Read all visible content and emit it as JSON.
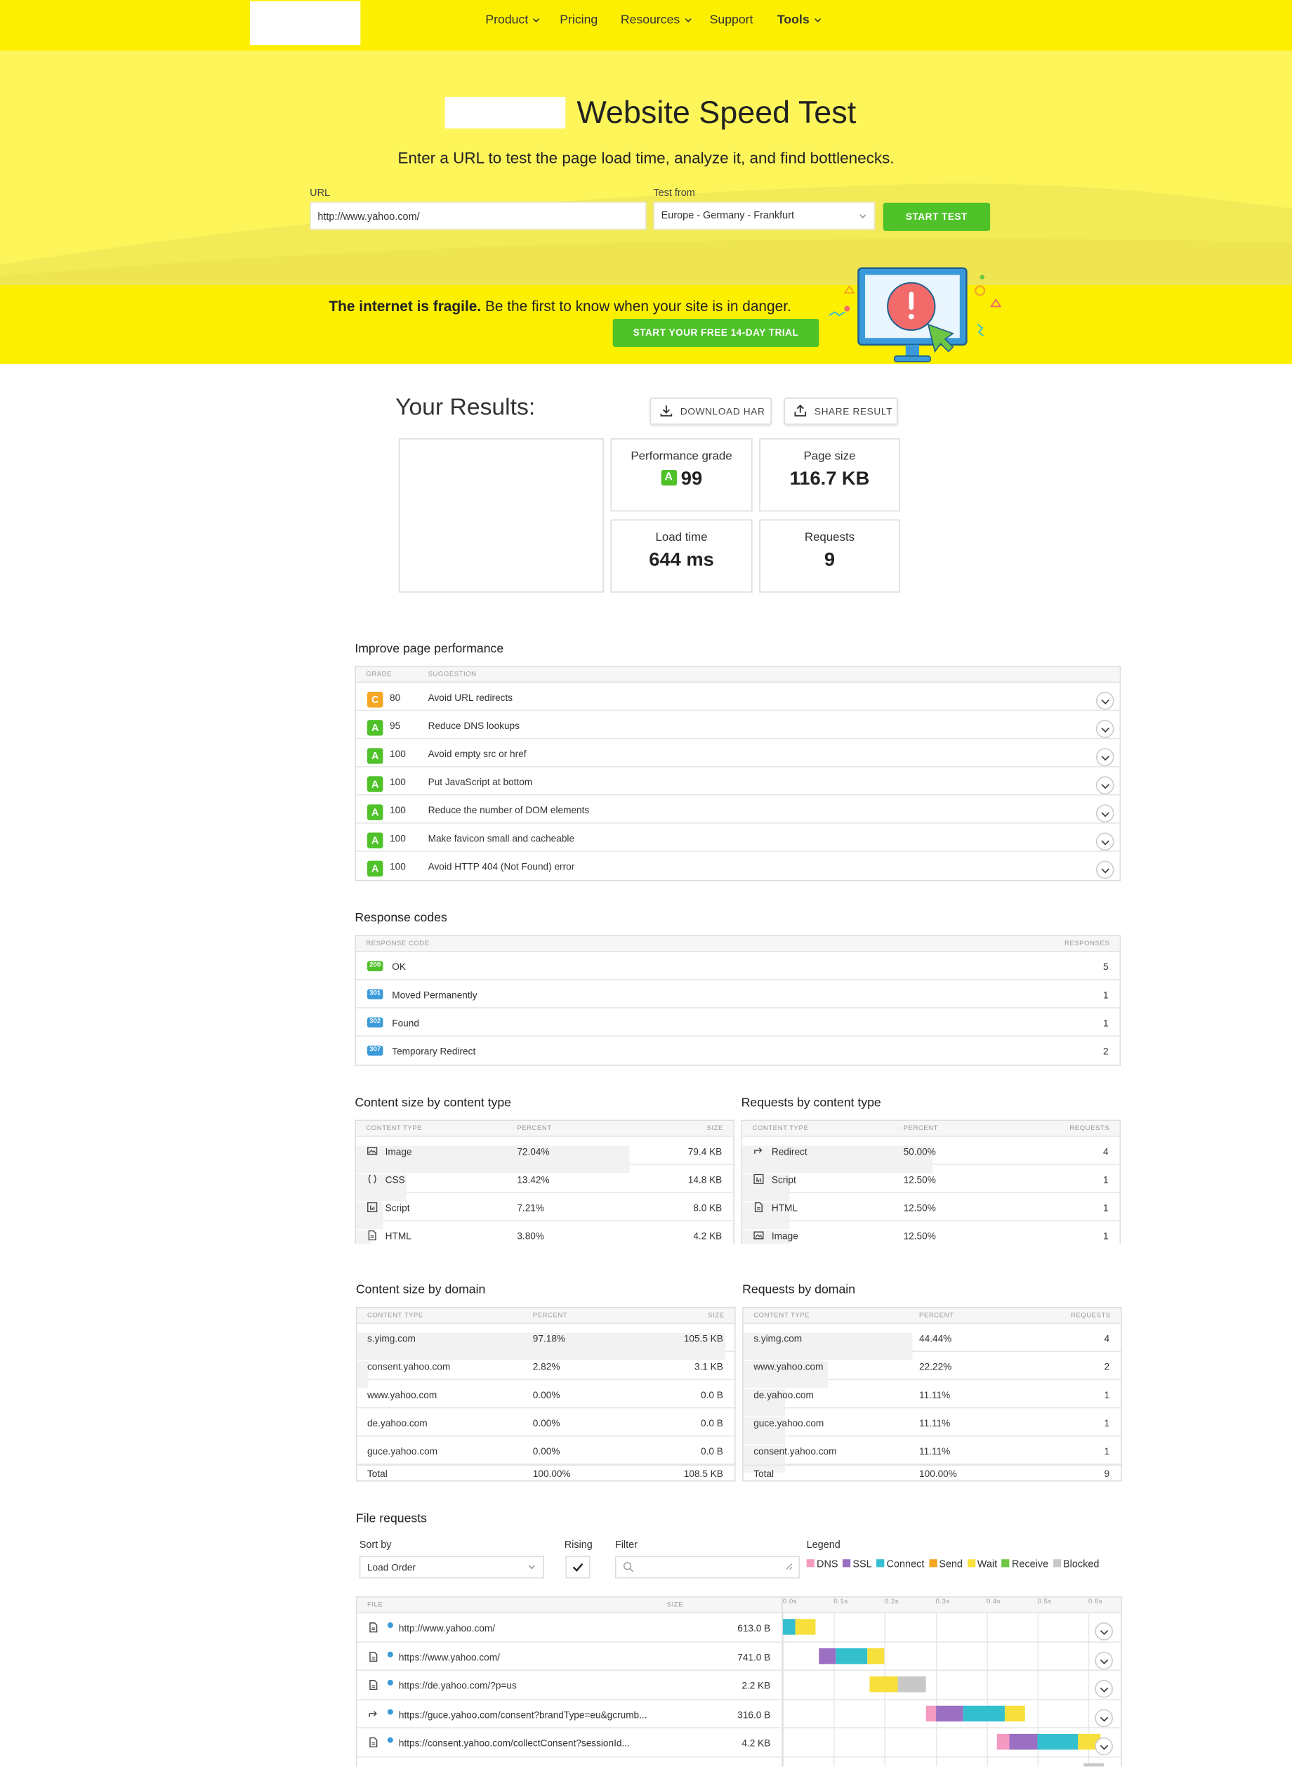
{
  "nav": {
    "items": [
      {
        "label": "Product",
        "dropdown": true
      },
      {
        "label": "Pricing",
        "dropdown": false
      },
      {
        "label": "Resources",
        "dropdown": true
      },
      {
        "label": "Support",
        "dropdown": false
      },
      {
        "label": "Tools",
        "dropdown": true
      }
    ]
  },
  "hero": {
    "title": "Website Speed Test",
    "subtitle": "Enter a URL to test the page load time, analyze it, and find bottlenecks.",
    "url_label": "URL",
    "url_value": "http://www.yahoo.com/",
    "test_from_label": "Test from",
    "test_from_value": "Europe - Germany - Frankfurt",
    "start_button": "START TEST"
  },
  "promo": {
    "bold": "The internet is fragile.",
    "text": " Be the first to know when your site is in danger.",
    "button": "START YOUR FREE 14-DAY TRIAL"
  },
  "results": {
    "title": "Your Results:",
    "download_har": "DOWNLOAD HAR",
    "share_result": "SHARE RESULT",
    "performance_grade_label": "Performance grade",
    "performance_grade_letter": "A",
    "performance_grade_value": "99",
    "page_size_label": "Page size",
    "page_size_value": "116.7 KB",
    "load_time_label": "Load time",
    "load_time_value": "644 ms",
    "requests_label": "Requests",
    "requests_value": "9"
  },
  "improve": {
    "title": "Improve page performance",
    "col_grade": "GRADE",
    "col_suggestion": "SUGGESTION",
    "rows": [
      {
        "grade": "C",
        "score": "80",
        "suggestion": "Avoid URL redirects",
        "color": "#f5a623"
      },
      {
        "grade": "A",
        "score": "95",
        "suggestion": "Reduce DNS lookups",
        "color": "#4fc22a"
      },
      {
        "grade": "A",
        "score": "100",
        "suggestion": "Avoid empty src or href",
        "color": "#4fc22a"
      },
      {
        "grade": "A",
        "score": "100",
        "suggestion": "Put JavaScript at bottom",
        "color": "#4fc22a"
      },
      {
        "grade": "A",
        "score": "100",
        "suggestion": "Reduce the number of DOM elements",
        "color": "#4fc22a"
      },
      {
        "grade": "A",
        "score": "100",
        "suggestion": "Make favicon small and cacheable",
        "color": "#4fc22a"
      },
      {
        "grade": "A",
        "score": "100",
        "suggestion": "Avoid HTTP 404 (Not Found) error",
        "color": "#4fc22a"
      }
    ]
  },
  "response_codes": {
    "title": "Response codes",
    "col_code": "RESPONSE CODE",
    "col_responses": "RESPONSES",
    "rows": [
      {
        "code": "200",
        "label": "OK",
        "count": "5",
        "color": "#4fc22a"
      },
      {
        "code": "301",
        "label": "Moved Permanently",
        "count": "1",
        "color": "#3a9ad9"
      },
      {
        "code": "302",
        "label": "Found",
        "count": "1",
        "color": "#3a9ad9"
      },
      {
        "code": "307",
        "label": "Temporary Redirect",
        "count": "2",
        "color": "#3a9ad9"
      }
    ]
  },
  "content_size_type": {
    "title": "Content size by content type",
    "col_type": "CONTENT TYPE",
    "col_percent": "PERCENT",
    "col_size": "SIZE",
    "rows": [
      {
        "type": "Image",
        "icon": "image-icon",
        "percent": "72.04%",
        "fraction": 0.7204,
        "size": "79.4 KB"
      },
      {
        "type": "CSS",
        "icon": "css-icon",
        "percent": "13.42%",
        "fraction": 0.1342,
        "size": "14.8 KB"
      },
      {
        "type": "Script",
        "icon": "script-icon",
        "percent": "7.21%",
        "fraction": 0.0721,
        "size": "8.0 KB"
      },
      {
        "type": "HTML",
        "icon": "html-icon",
        "percent": "3.80%",
        "fraction": 0.038,
        "size": "4.2 KB"
      }
    ]
  },
  "requests_type": {
    "title": "Requests by content type",
    "col_type": "CONTENT TYPE",
    "col_percent": "PERCENT",
    "col_requests": "REQUESTS",
    "rows": [
      {
        "type": "Redirect",
        "icon": "redirect-icon",
        "percent": "50.00%",
        "fraction": 0.5,
        "count": "4"
      },
      {
        "type": "Script",
        "icon": "script-icon",
        "percent": "12.50%",
        "fraction": 0.125,
        "count": "1"
      },
      {
        "type": "HTML",
        "icon": "html-icon",
        "percent": "12.50%",
        "fraction": 0.125,
        "count": "1"
      },
      {
        "type": "Image",
        "icon": "image-icon",
        "percent": "12.50%",
        "fraction": 0.125,
        "count": "1"
      }
    ]
  },
  "content_size_domain": {
    "title": "Content size by domain",
    "col_type": "CONTENT TYPE",
    "col_percent": "PERCENT",
    "col_size": "SIZE",
    "rows": [
      {
        "domain": "s.yimg.com",
        "percent": "97.18%",
        "fraction": 0.9718,
        "size": "105.5 KB"
      },
      {
        "domain": "consent.yahoo.com",
        "percent": "2.82%",
        "fraction": 0.0282,
        "size": "3.1 KB"
      },
      {
        "domain": "www.yahoo.com",
        "percent": "0.00%",
        "fraction": 0,
        "size": "0.0 B"
      },
      {
        "domain": "de.yahoo.com",
        "percent": "0.00%",
        "fraction": 0,
        "size": "0.0 B"
      },
      {
        "domain": "guce.yahoo.com",
        "percent": "0.00%",
        "fraction": 0,
        "size": "0.0 B"
      }
    ],
    "total_label": "Total",
    "total_percent": "100.00%",
    "total_size": "108.5 KB"
  },
  "requests_domain": {
    "title": "Requests by domain",
    "col_type": "CONTENT TYPE",
    "col_percent": "PERCENT",
    "col_requests": "REQUESTS",
    "rows": [
      {
        "domain": "s.yimg.com",
        "percent": "44.44%",
        "fraction": 0.4444,
        "count": "4"
      },
      {
        "domain": "www.yahoo.com",
        "percent": "22.22%",
        "fraction": 0.2222,
        "count": "2"
      },
      {
        "domain": "de.yahoo.com",
        "percent": "11.11%",
        "fraction": 0.1111,
        "count": "1"
      },
      {
        "domain": "guce.yahoo.com",
        "percent": "11.11%",
        "fraction": 0.1111,
        "count": "1"
      },
      {
        "domain": "consent.yahoo.com",
        "percent": "11.11%",
        "fraction": 0.1111,
        "count": "1"
      }
    ],
    "total_label": "Total",
    "total_percent": "100.00%",
    "total_count": "9"
  },
  "file_requests": {
    "title": "File requests",
    "sort_label": "Sort by",
    "sort_value": "Load Order",
    "rising_label": "Rising",
    "filter_label": "Filter",
    "filter_value": "",
    "legend_label": "Legend",
    "legend": [
      {
        "name": "DNS",
        "color": "#f49ac1"
      },
      {
        "name": "SSL",
        "color": "#9b6fc2"
      },
      {
        "name": "Connect",
        "color": "#34bfcf"
      },
      {
        "name": "Send",
        "color": "#f5a623"
      },
      {
        "name": "Wait",
        "color": "#f7e03c"
      },
      {
        "name": "Receive",
        "color": "#6cc644"
      },
      {
        "name": "Blocked",
        "color": "#c8c8c8"
      }
    ],
    "col_file": "FILE",
    "col_size": "SIZE",
    "ticks": [
      "0.0s",
      "0.1s",
      "0.2s",
      "0.3s",
      "0.4s",
      "0.5s",
      "0.6s"
    ],
    "rows": [
      {
        "url": "http://www.yahoo.com/",
        "size": "613.0 B",
        "icon": "document-icon",
        "phases": [
          {
            "p": "Connect",
            "s": 0.0,
            "e": 0.025
          },
          {
            "p": "Wait",
            "s": 0.025,
            "e": 0.065
          }
        ]
      },
      {
        "url": "https://www.yahoo.com/",
        "size": "741.0 B",
        "icon": "document-icon",
        "phases": [
          {
            "p": "SSL",
            "s": 0.07,
            "e": 0.105
          },
          {
            "p": "Connect",
            "s": 0.105,
            "e": 0.165
          },
          {
            "p": "Wait",
            "s": 0.165,
            "e": 0.2
          }
        ]
      },
      {
        "url": "https://de.yahoo.com/?p=us",
        "size": "2.2 KB",
        "icon": "document-icon",
        "phases": [
          {
            "p": "Wait",
            "s": 0.17,
            "e": 0.225
          },
          {
            "p": "Blocked",
            "s": 0.225,
            "e": 0.28
          }
        ]
      },
      {
        "url": "https://guce.yahoo.com/consent?brandType=eu&gcrumb...",
        "size": "316.0 B",
        "icon": "redirect-icon",
        "phases": [
          {
            "p": "DNS",
            "s": 0.28,
            "e": 0.3
          },
          {
            "p": "SSL",
            "s": 0.3,
            "e": 0.355
          },
          {
            "p": "Connect",
            "s": 0.355,
            "e": 0.435
          },
          {
            "p": "Wait",
            "s": 0.435,
            "e": 0.475
          }
        ]
      },
      {
        "url": "https://consent.yahoo.com/collectConsent?sessionId...",
        "size": "4.2 KB",
        "icon": "document-icon",
        "phases": [
          {
            "p": "DNS",
            "s": 0.42,
            "e": 0.445
          },
          {
            "p": "SSL",
            "s": 0.445,
            "e": 0.5
          },
          {
            "p": "Connect",
            "s": 0.5,
            "e": 0.58
          },
          {
            "p": "Wait",
            "s": 0.58,
            "e": 0.625
          }
        ]
      }
    ]
  }
}
